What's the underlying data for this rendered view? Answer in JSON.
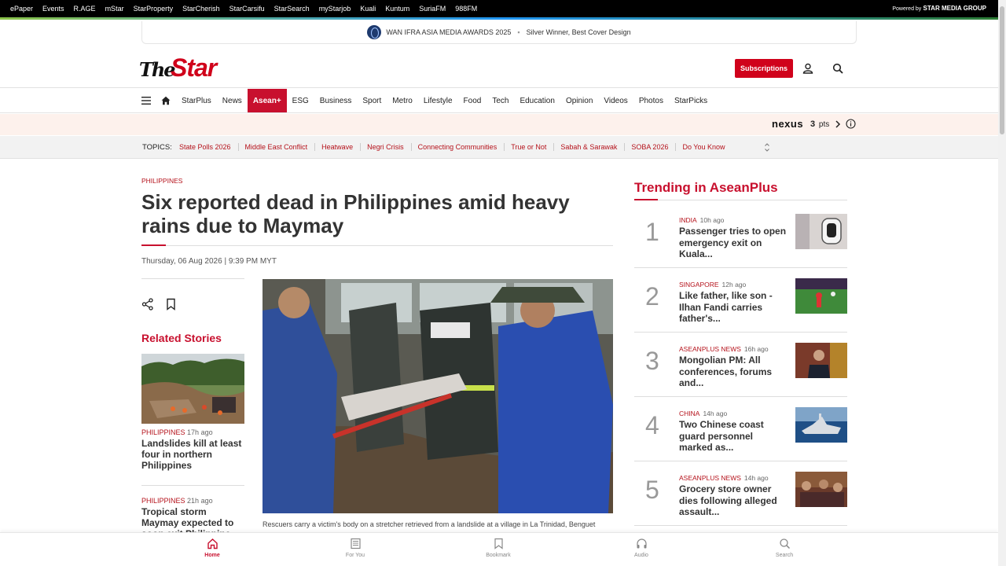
{
  "network_bar": {
    "links": [
      "ePaper",
      "Events",
      "R.AGE",
      "mStar",
      "StarProperty",
      "StarCherish",
      "StarCarsifu",
      "StarSearch",
      "myStarjob",
      "Kuali",
      "Kuntum",
      "SuriaFM",
      "988FM"
    ],
    "powered_prefix": "Powered by",
    "powered_brand": "STAR MEDIA GROUP"
  },
  "awards": {
    "title": "WAN IFRA ASIA MEDIA AWARDS 2025",
    "award": "Silver Winner, Best Cover Design"
  },
  "header": {
    "logo_the": "The",
    "logo_star": "Star",
    "subscribe_label": "Subscriptions"
  },
  "nav": {
    "items": [
      "StarPlus",
      "News",
      "Asean+",
      "ESG",
      "Business",
      "Sport",
      "Metro",
      "Lifestyle",
      "Food",
      "Tech",
      "Education",
      "Opinion",
      "Videos",
      "Photos",
      "StarPicks"
    ],
    "active": "Asean+"
  },
  "nexus": {
    "brand": "nexus",
    "points": "3",
    "points_unit": "pts"
  },
  "topics": {
    "label": "TOPICS:",
    "items": [
      "State Polls 2026",
      "Middle East Conflict",
      "Heatwave",
      "Negri Crisis",
      "Connecting Communities",
      "True or Not",
      "Sabah & Sarawak",
      "SOBA 2026",
      "Do You Know"
    ]
  },
  "article": {
    "kicker": "PHILIPPINES",
    "headline": "Six reported dead in Philippines amid heavy rains due to Maymay",
    "dateline": "Thursday, 06 Aug 2026 | 9:39 PM MYT",
    "caption": "Rescuers carry a victim's body on a stretcher retrieved from a landslide at a village in La Trinidad, Benguet"
  },
  "related": {
    "title": "Related Stories",
    "items": [
      {
        "category": "PHILIPPINES",
        "time": "17h ago",
        "title": "Landslides kill at least four in northern Philippines"
      },
      {
        "category": "PHILIPPINES",
        "time": "21h ago",
        "title": "Tropical storm Maymay expected to soon exit Philippine land..."
      }
    ]
  },
  "trending": {
    "title": "Trending in AseanPlus",
    "items": [
      {
        "rank": "1",
        "category": "INDIA",
        "time": "10h ago",
        "title": "Passenger tries to open emergency exit on Kuala..."
      },
      {
        "rank": "2",
        "category": "SINGAPORE",
        "time": "12h ago",
        "title": "Like father, like son - Ilhan Fandi carries father's..."
      },
      {
        "rank": "3",
        "category": "ASEANPLUS NEWS",
        "time": "16h ago",
        "title": "Mongolian PM: All conferences, forums and..."
      },
      {
        "rank": "4",
        "category": "CHINA",
        "time": "14h ago",
        "title": "Two Chinese coast guard personnel marked as..."
      },
      {
        "rank": "5",
        "category": "ASEANPLUS NEWS",
        "time": "14h ago",
        "title": "Grocery store owner dies following alleged assault..."
      }
    ]
  },
  "tabbar": {
    "items": [
      "Home",
      "For You",
      "Bookmark",
      "Audio",
      "Search"
    ],
    "active": "Home"
  },
  "colors": {
    "brand_red": "#c8102e",
    "kicker_red": "#b5121b"
  }
}
